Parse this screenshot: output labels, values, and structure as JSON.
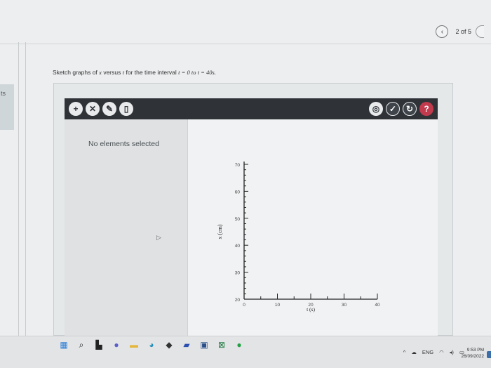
{
  "sidebar": {
    "partial_label": "ts"
  },
  "nav": {
    "prev_icon": "chevron-left-icon",
    "page_indicator": "2 of 5"
  },
  "question": {
    "text_before": "Sketch graphs of",
    "var_x": "x",
    "text_mid": "versus",
    "var_t": "t",
    "text_after": "for the time interval",
    "interval": "t = 0 to t = 40s."
  },
  "toolbar": {
    "left_tools": [
      "add-icon",
      "delete-point-icon",
      "edit-point-icon",
      "trash-icon"
    ],
    "right_tools": [
      "hint-icon",
      "check-icon",
      "reset-icon",
      "help-icon"
    ],
    "help_symbol": "?"
  },
  "selection_panel": {
    "message": "No elements selected"
  },
  "graph": {
    "ylabel": "x (cm)",
    "xlabel": "t (s)",
    "y_ticks": [
      "20",
      "30",
      "40",
      "50",
      "60",
      "70"
    ],
    "x_ticks": [
      "0",
      "10",
      "20",
      "30",
      "40"
    ]
  },
  "taskbar": {
    "icons": [
      "windows-icon",
      "search-icon",
      "taskview-icon",
      "chat-icon",
      "file-explorer-icon",
      "edge-icon",
      "app-icon",
      "app-icon-2",
      "app-icon-3",
      "app-icon-4",
      "whatsapp-icon"
    ],
    "tray": {
      "lang": "ENG",
      "time": "9:53 PM",
      "date": "26/09/2022"
    }
  },
  "colors": {
    "toolbar_bg": "#2f3338",
    "help_button": "#c13a4e",
    "accent_blue": "#3b6ea8"
  }
}
